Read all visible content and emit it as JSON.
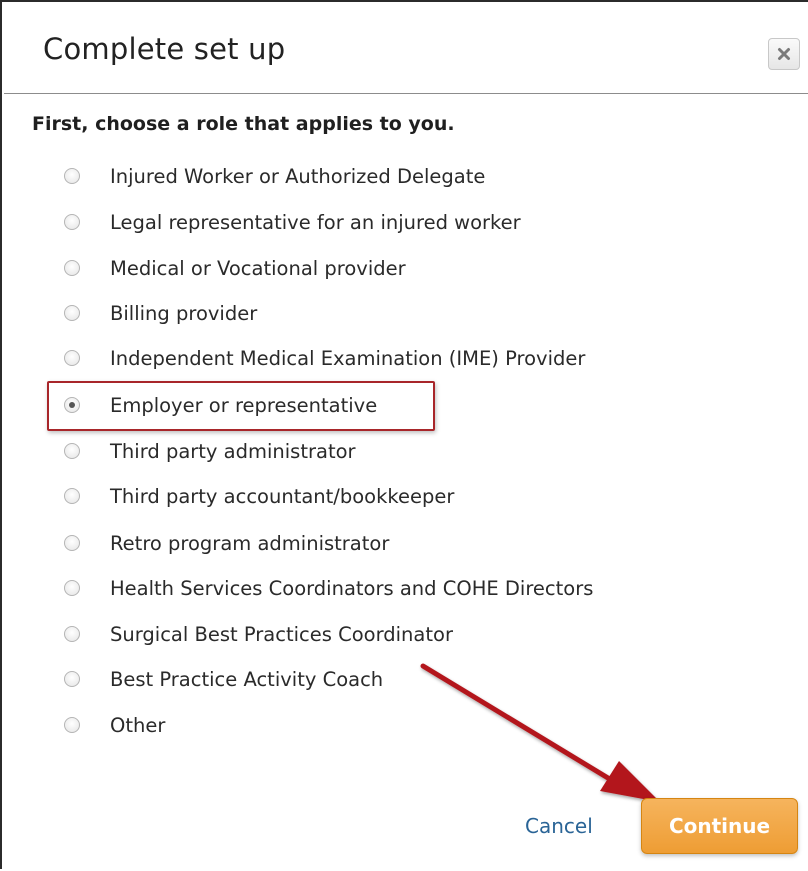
{
  "dialog": {
    "title": "Complete set up",
    "close_icon": "close-icon",
    "prompt": "First, choose a role that applies to you."
  },
  "roles": {
    "selected_index": 5,
    "options": [
      {
        "label": "Injured Worker or Authorized Delegate"
      },
      {
        "label": "Legal representative for an injured worker"
      },
      {
        "label": "Medical or Vocational provider"
      },
      {
        "label": "Billing provider"
      },
      {
        "label": "Independent Medical Examination (IME) Provider"
      },
      {
        "label": "Employer or representative"
      },
      {
        "label": "Third party administrator"
      },
      {
        "label": "Third party accountant/bookkeeper"
      },
      {
        "label": "Retro program administrator"
      },
      {
        "label": "Health Services Coordinators and COHE Directors"
      },
      {
        "label": "Surgical Best Practices Coordinator"
      },
      {
        "label": "Best Practice Activity Coach"
      },
      {
        "label": "Other"
      }
    ]
  },
  "actions": {
    "cancel_label": "Cancel",
    "continue_label": "Continue"
  },
  "colors": {
    "highlight_border": "#a8262a",
    "arrow": "#b3191e",
    "continue_button": "#f0a23d",
    "cancel_link": "#2a6496"
  }
}
